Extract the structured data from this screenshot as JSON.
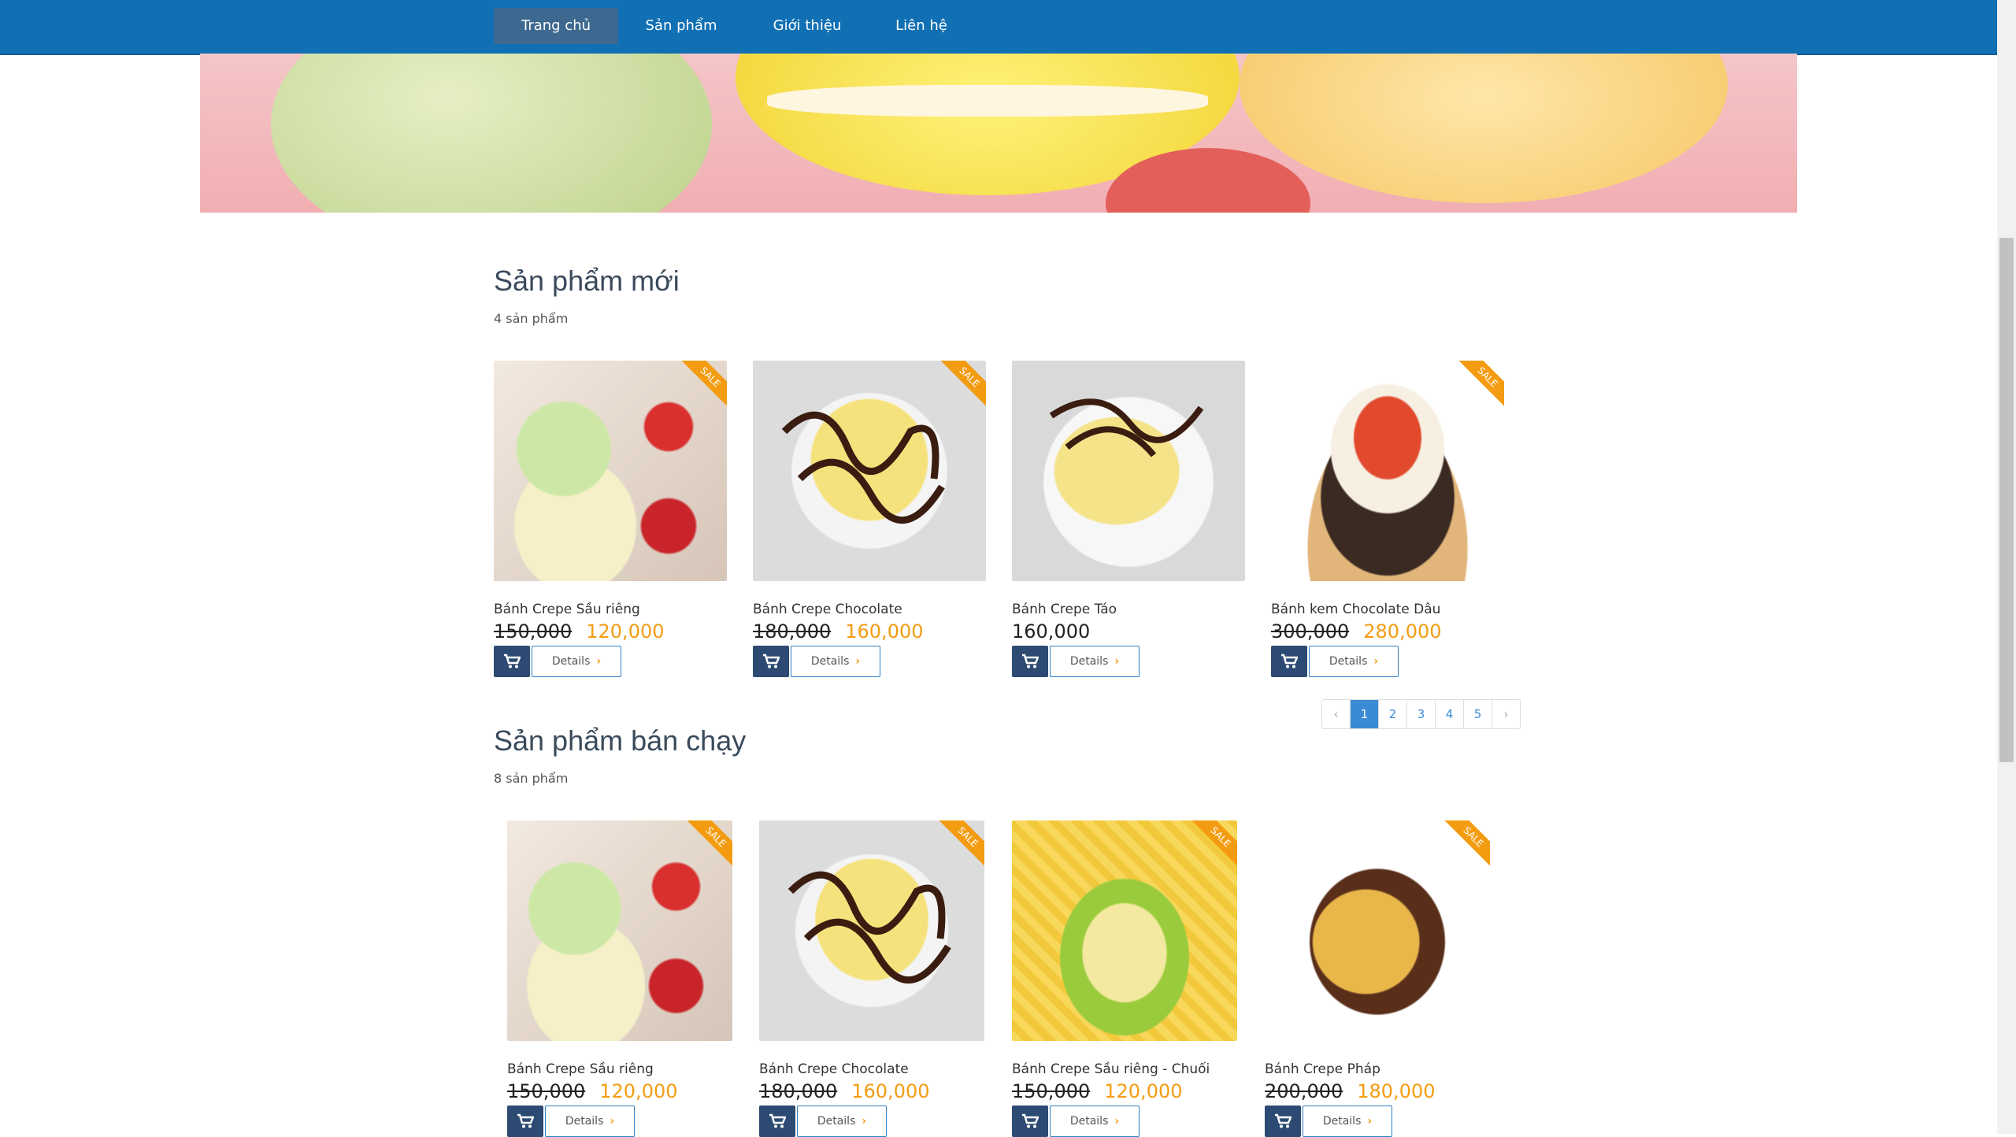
{
  "nav": {
    "items": [
      {
        "label": "Trang chủ",
        "active": true
      },
      {
        "label": "Sản phẩm",
        "active": false
      },
      {
        "label": "Giới thiệu",
        "active": false
      },
      {
        "label": "Liên hệ",
        "active": false
      }
    ]
  },
  "sections": {
    "new": {
      "title": "Sản phẩm mới",
      "count": "4 sản phẩm",
      "products": [
        {
          "name": "Bánh Crepe Sầu riêng",
          "old_price": "150,000",
          "price": "120,000",
          "sale": "SALE"
        },
        {
          "name": "Bánh Crepe Chocolate",
          "old_price": "180,000",
          "price": "160,000",
          "sale": "SALE"
        },
        {
          "name": "Bánh Crepe Táo",
          "price": "160,000"
        },
        {
          "name": "Bánh kem Chocolate Dâu",
          "old_price": "300,000",
          "price": "280,000",
          "sale": "SALE"
        }
      ]
    },
    "best": {
      "title": "Sản phẩm bán chạy",
      "count": "8 sản phẩm",
      "products": [
        {
          "name": "Bánh Crepe Sầu riêng",
          "old_price": "150,000",
          "price": "120,000",
          "sale": "SALE"
        },
        {
          "name": "Bánh Crepe Chocolate",
          "old_price": "180,000",
          "price": "160,000",
          "sale": "SALE"
        },
        {
          "name": "Bánh Crepe Sầu riêng - Chuối",
          "old_price": "150,000",
          "price": "120,000",
          "sale": "SALE"
        },
        {
          "name": "Bánh Crepe Pháp",
          "old_price": "200,000",
          "price": "180,000",
          "sale": "SALE"
        }
      ]
    }
  },
  "buttons": {
    "details": "Details"
  },
  "pagination": {
    "prev": "‹",
    "pages": [
      "1",
      "2",
      "3",
      "4",
      "5"
    ],
    "next": "›",
    "current": "1"
  },
  "colors": {
    "navbar": "#1170b4",
    "nav_active": "#3d6990",
    "accent": "#f39c12",
    "cart": "#2d4b72"
  },
  "icons": [
    "cart-icon",
    "chevron-right-icon"
  ]
}
